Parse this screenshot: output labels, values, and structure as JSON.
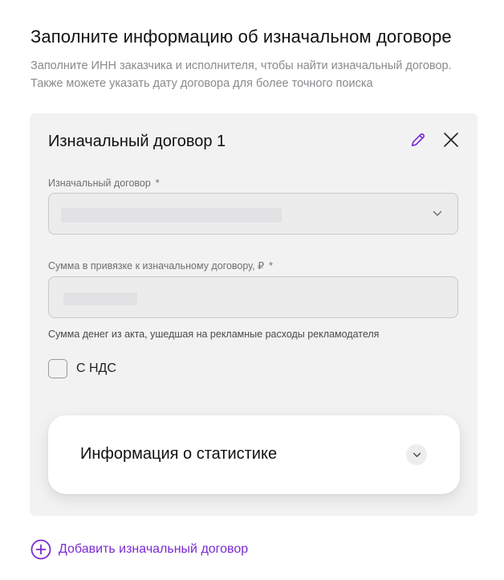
{
  "header": {
    "title": "Заполните информацию об изначальном договоре",
    "subtitle": "Заполните ИНН заказчика и исполнителя, чтобы найти изначальный договор. Также можете указать дату договора для более точного поиска"
  },
  "contract_card": {
    "title": "Изначальный договор 1",
    "edit_icon": "pencil-icon",
    "close_icon": "close-icon",
    "contract_field": {
      "label": "Изначальный договор",
      "required_mark": "*",
      "value": "",
      "icon": "chevron-down-icon"
    },
    "amount_field": {
      "label": "Сумма в привязке к изначальному договору, ₽",
      "required_mark": "*",
      "value": "",
      "hint": "Сумма денег из акта, ушедшая на рекламные расходы рекламодателя"
    },
    "vat_checkbox": {
      "label": "С НДС",
      "checked": false
    },
    "stats_panel": {
      "title": "Информация о статистике",
      "icon": "chevron-down-icon",
      "expanded": false
    }
  },
  "add_contract": {
    "label": "Добавить изначальный договор",
    "icon": "plus-circle-icon"
  },
  "colors": {
    "accent": "#7a2bd1",
    "card_background": "#f2f2f2",
    "field_background": "#ececec",
    "field_border": "#c9c9cc",
    "muted_text": "#8a8a8f"
  }
}
